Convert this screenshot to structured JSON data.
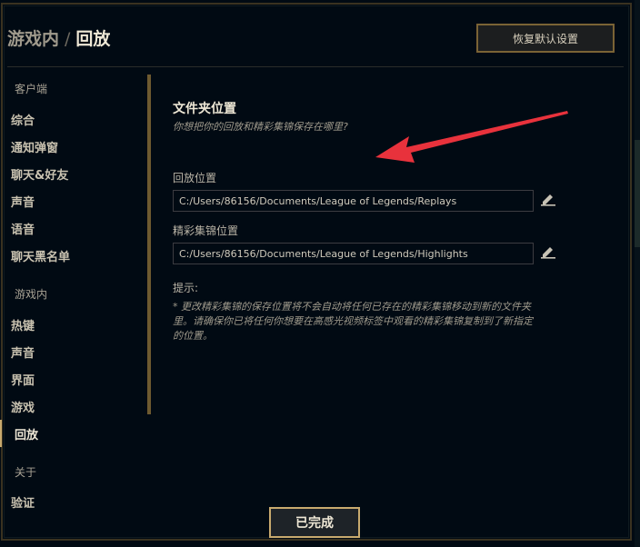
{
  "header": {
    "breadcrumb_parent": "游戏内",
    "breadcrumb_separator": "/",
    "breadcrumb_current": "回放",
    "reset_button": "恢复默认设置"
  },
  "sidebar": {
    "section_client": "客户端",
    "client_items": [
      "综合",
      "通知弹窗",
      "聊天&好友",
      "声音",
      "语音",
      "聊天黑名单"
    ],
    "section_ingame": "游戏内",
    "ingame_items": [
      "热键",
      "声音",
      "界面",
      "游戏",
      "回放"
    ],
    "active_item": "回放",
    "section_about": "关于",
    "about_items": [
      "验证"
    ]
  },
  "content": {
    "heading": "文件夹位置",
    "subheading": "你想把你的回放和精彩集锦保存在哪里?",
    "replay_label": "回放位置",
    "replay_path": "C:/Users/86156/Documents/League of Legends/Replays",
    "highlight_label": "精彩集锦位置",
    "highlight_path": "C:/Users/86156/Documents/League of Legends/Highlights",
    "hint_label": "提示:",
    "hint_text": "* 更改精彩集锦的保存位置将不会自动将任何已存在的精彩集锦移动到新的文件夹里。请确保你已将任何你想要在高感光视频标签中观看的精彩集锦复制到了新指定的位置。"
  },
  "footer": {
    "done_button": "已完成"
  },
  "icons": {
    "edit": "pencil-edit-icon",
    "annotation": "red-arrow-icon"
  },
  "colors": {
    "background": "#010a13",
    "gold_border": "#c8aa6e",
    "text_light": "#efe8d6",
    "arrow": "#e8323c"
  }
}
